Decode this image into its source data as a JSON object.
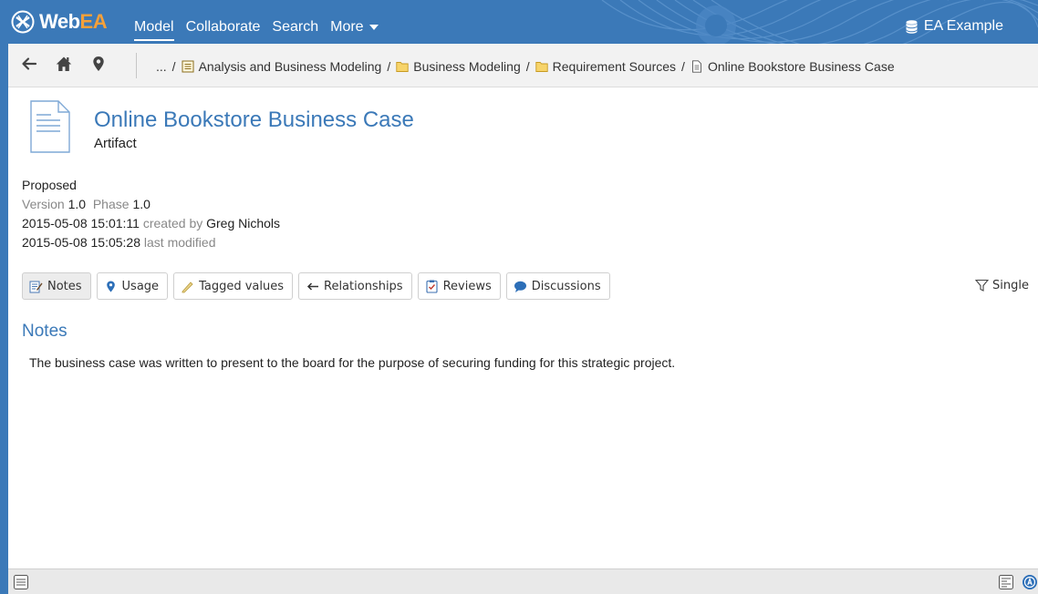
{
  "app": {
    "logo_prefix": "Web",
    "logo_suffix": "EA",
    "model_name": "EA Example"
  },
  "nav": {
    "items": [
      "Model",
      "Collaborate",
      "Search",
      "More"
    ]
  },
  "breadcrumb": {
    "ellipsis": "...",
    "items": [
      {
        "label": "Analysis and Business Modeling",
        "icon": "package-diagram-icon"
      },
      {
        "label": "Business Modeling",
        "icon": "folder-icon"
      },
      {
        "label": "Requirement Sources",
        "icon": "folder-icon"
      },
      {
        "label": "Online Bookstore Business Case",
        "icon": "document-icon"
      }
    ]
  },
  "element": {
    "title": "Online Bookstore Business Case",
    "type": "Artifact",
    "status": "Proposed",
    "version_label": "Version",
    "version": "1.0",
    "phase_label": "Phase",
    "phase": "1.0",
    "created": "2015-05-08 15:01:11",
    "created_by_label": "created by",
    "author": "Greg Nichols",
    "modified": "2015-05-08 15:05:28",
    "modified_label": "last modified"
  },
  "tabs": [
    {
      "label": "Notes",
      "icon": "notes-icon"
    },
    {
      "label": "Usage",
      "icon": "usage-icon"
    },
    {
      "label": "Tagged values",
      "icon": "tag-icon"
    },
    {
      "label": "Relationships",
      "icon": "arrow-left-icon"
    },
    {
      "label": "Reviews",
      "icon": "review-icon"
    },
    {
      "label": "Discussions",
      "icon": "chat-icon"
    }
  ],
  "filter": {
    "label": "Single"
  },
  "notes": {
    "heading": "Notes",
    "text": "The business case was written to present to the board for the purpose of securing funding for this strategic project."
  },
  "colors": {
    "brand": "#3b79b8",
    "accent": "#f4a03a"
  }
}
